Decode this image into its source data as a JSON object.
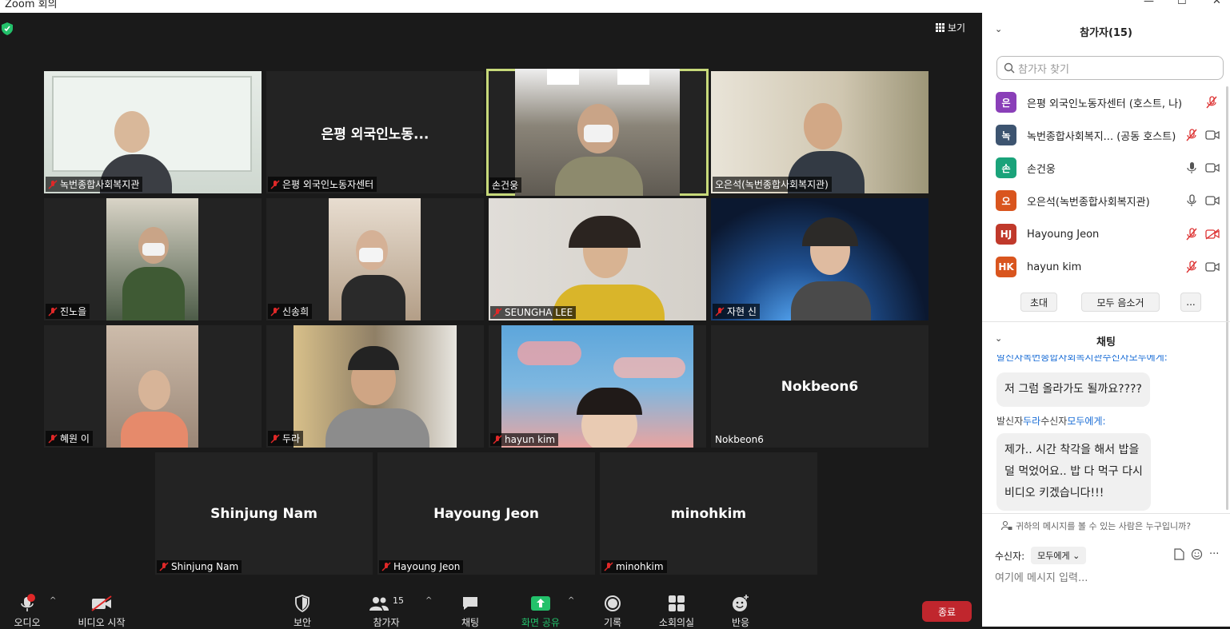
{
  "window": {
    "title": "Zoom 회의",
    "minimize": "—",
    "maximize": "☐",
    "close": "✕"
  },
  "view_button": {
    "label": "보기"
  },
  "tiles": [
    {
      "name": "녹번종합사회복지관",
      "muted": true,
      "video": true,
      "bg": "#e8eee9"
    },
    {
      "name": "은평 외국인노동자센터",
      "muted": true,
      "video": false,
      "display_name": "은평 외국인노동..."
    },
    {
      "name": "손건웅",
      "muted": false,
      "video": true,
      "active": true,
      "bg": "#6f6a62"
    },
    {
      "name": "오은석(녹번종합사회복지관)",
      "muted": false,
      "video": true,
      "bg": "#d8d2c4"
    },
    {
      "name": "진노을",
      "muted": true,
      "video": true,
      "bg": "#4a5b45"
    },
    {
      "name": "신송희",
      "muted": true,
      "video": true,
      "bg": "#c9b8a3"
    },
    {
      "name": "SEUNGHA LEE",
      "muted": true,
      "video": true,
      "bg": "#d9d5cf"
    },
    {
      "name": "자현 신",
      "muted": true,
      "video": true,
      "bg": "#1d3a63"
    },
    {
      "name": "혜원 이",
      "muted": true,
      "video": true,
      "bg": "#b69d8e"
    },
    {
      "name": "두라",
      "muted": true,
      "video": true,
      "bg": "#9a8a6f"
    },
    {
      "name": "hayun kim",
      "muted": true,
      "video": true,
      "bg": "#5aa0d6"
    },
    {
      "name": "Nokbeon6",
      "muted": false,
      "video": false,
      "display_name": "Nokbeon6"
    },
    {
      "name": "Shinjung Nam",
      "muted": true,
      "video": false,
      "display_name": "Shinjung Nam"
    },
    {
      "name": "Hayoung Jeon",
      "muted": true,
      "video": false,
      "display_name": "Hayoung Jeon"
    },
    {
      "name": "minohkim",
      "muted": true,
      "video": false,
      "display_name": "minohkim"
    }
  ],
  "toolbar": {
    "audio": "오디오",
    "video": "비디오 시작",
    "security": "보안",
    "participants": "참가자",
    "participants_count": "15",
    "chat": "채팅",
    "share": "화면 공유",
    "record": "기록",
    "breakout": "소회의실",
    "reactions": "반응",
    "end": "종료",
    "audio_alert": "!"
  },
  "panel": {
    "participants_title": "참가자(15)",
    "search_placeholder": "참가자 찾기",
    "participants": [
      {
        "initial": "은",
        "name": "은평 외국인노동자센터 (호스트, 나)",
        "color": "#8a3fb8",
        "mic": "muted",
        "cam": "none"
      },
      {
        "initial": "녹",
        "name": "녹번종합사회복지... (공동 호스트)",
        "color": "#3d5470",
        "mic": "muted",
        "cam": "on"
      },
      {
        "initial": "손",
        "name": "손건웅",
        "color": "#1aa37a",
        "mic": "on",
        "cam": "on"
      },
      {
        "initial": "오",
        "name": "오은석(녹번종합사회복지관)",
        "color": "#d9551e",
        "mic": "on",
        "cam": "on"
      },
      {
        "initial": "HJ",
        "name": "Hayoung Jeon",
        "color": "#c0392b",
        "mic": "muted",
        "cam": "off"
      },
      {
        "initial": "HK",
        "name": "hayun kim",
        "color": "#d9551e",
        "mic": "muted",
        "cam": "on"
      }
    ],
    "invite": "초대",
    "mute_all": "모두 음소거",
    "more": "...",
    "chat_title": "채팅",
    "chat_partial": "발신자녹번종합사회복지관수신자모두에게:",
    "msg1": "저 그럼 올라가도 될까요????",
    "meta2_prefix": "발신자",
    "meta2_sender": "두라",
    "meta2_mid": "수신자",
    "meta2_to": "모두에게:",
    "msg2_l1": "제가.. 시간 착각을 해서 밥을",
    "msg2_l2": "덜 먹었어요.. 밥 다 먹구 다시",
    "msg2_l3": "비디오 키겠습니다!!!",
    "who_can_see": "귀하의 메시지를 볼 수 있는 사람은 누구입니까?",
    "recipient_label": "수신자:",
    "recipient_value": "모두에게",
    "input_placeholder": "여기에 메시지 입력..."
  }
}
